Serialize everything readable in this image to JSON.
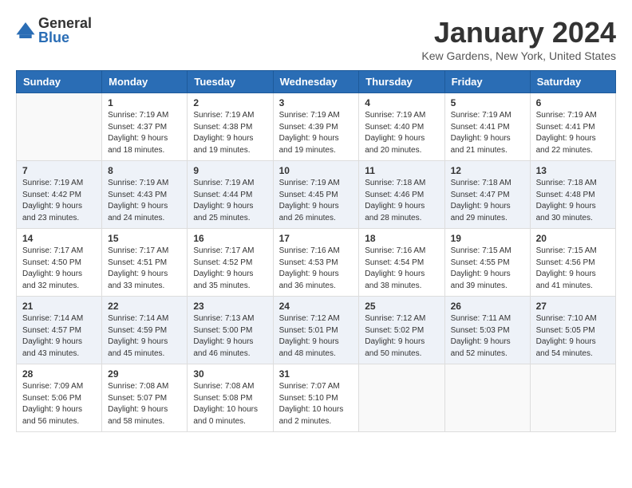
{
  "header": {
    "logo_general": "General",
    "logo_blue": "Blue",
    "month_year": "January 2024",
    "location": "Kew Gardens, New York, United States"
  },
  "days_of_week": [
    "Sunday",
    "Monday",
    "Tuesday",
    "Wednesday",
    "Thursday",
    "Friday",
    "Saturday"
  ],
  "weeks": [
    [
      {
        "day": "",
        "sunrise": "",
        "sunset": "",
        "daylight": "",
        "empty": true
      },
      {
        "day": "1",
        "sunrise": "Sunrise: 7:19 AM",
        "sunset": "Sunset: 4:37 PM",
        "daylight": "Daylight: 9 hours and 18 minutes."
      },
      {
        "day": "2",
        "sunrise": "Sunrise: 7:19 AM",
        "sunset": "Sunset: 4:38 PM",
        "daylight": "Daylight: 9 hours and 19 minutes."
      },
      {
        "day": "3",
        "sunrise": "Sunrise: 7:19 AM",
        "sunset": "Sunset: 4:39 PM",
        "daylight": "Daylight: 9 hours and 19 minutes."
      },
      {
        "day": "4",
        "sunrise": "Sunrise: 7:19 AM",
        "sunset": "Sunset: 4:40 PM",
        "daylight": "Daylight: 9 hours and 20 minutes."
      },
      {
        "day": "5",
        "sunrise": "Sunrise: 7:19 AM",
        "sunset": "Sunset: 4:41 PM",
        "daylight": "Daylight: 9 hours and 21 minutes."
      },
      {
        "day": "6",
        "sunrise": "Sunrise: 7:19 AM",
        "sunset": "Sunset: 4:41 PM",
        "daylight": "Daylight: 9 hours and 22 minutes."
      }
    ],
    [
      {
        "day": "7",
        "sunrise": "Sunrise: 7:19 AM",
        "sunset": "Sunset: 4:42 PM",
        "daylight": "Daylight: 9 hours and 23 minutes."
      },
      {
        "day": "8",
        "sunrise": "Sunrise: 7:19 AM",
        "sunset": "Sunset: 4:43 PM",
        "daylight": "Daylight: 9 hours and 24 minutes."
      },
      {
        "day": "9",
        "sunrise": "Sunrise: 7:19 AM",
        "sunset": "Sunset: 4:44 PM",
        "daylight": "Daylight: 9 hours and 25 minutes."
      },
      {
        "day": "10",
        "sunrise": "Sunrise: 7:19 AM",
        "sunset": "Sunset: 4:45 PM",
        "daylight": "Daylight: 9 hours and 26 minutes."
      },
      {
        "day": "11",
        "sunrise": "Sunrise: 7:18 AM",
        "sunset": "Sunset: 4:46 PM",
        "daylight": "Daylight: 9 hours and 28 minutes."
      },
      {
        "day": "12",
        "sunrise": "Sunrise: 7:18 AM",
        "sunset": "Sunset: 4:47 PM",
        "daylight": "Daylight: 9 hours and 29 minutes."
      },
      {
        "day": "13",
        "sunrise": "Sunrise: 7:18 AM",
        "sunset": "Sunset: 4:48 PM",
        "daylight": "Daylight: 9 hours and 30 minutes."
      }
    ],
    [
      {
        "day": "14",
        "sunrise": "Sunrise: 7:17 AM",
        "sunset": "Sunset: 4:50 PM",
        "daylight": "Daylight: 9 hours and 32 minutes."
      },
      {
        "day": "15",
        "sunrise": "Sunrise: 7:17 AM",
        "sunset": "Sunset: 4:51 PM",
        "daylight": "Daylight: 9 hours and 33 minutes."
      },
      {
        "day": "16",
        "sunrise": "Sunrise: 7:17 AM",
        "sunset": "Sunset: 4:52 PM",
        "daylight": "Daylight: 9 hours and 35 minutes."
      },
      {
        "day": "17",
        "sunrise": "Sunrise: 7:16 AM",
        "sunset": "Sunset: 4:53 PM",
        "daylight": "Daylight: 9 hours and 36 minutes."
      },
      {
        "day": "18",
        "sunrise": "Sunrise: 7:16 AM",
        "sunset": "Sunset: 4:54 PM",
        "daylight": "Daylight: 9 hours and 38 minutes."
      },
      {
        "day": "19",
        "sunrise": "Sunrise: 7:15 AM",
        "sunset": "Sunset: 4:55 PM",
        "daylight": "Daylight: 9 hours and 39 minutes."
      },
      {
        "day": "20",
        "sunrise": "Sunrise: 7:15 AM",
        "sunset": "Sunset: 4:56 PM",
        "daylight": "Daylight: 9 hours and 41 minutes."
      }
    ],
    [
      {
        "day": "21",
        "sunrise": "Sunrise: 7:14 AM",
        "sunset": "Sunset: 4:57 PM",
        "daylight": "Daylight: 9 hours and 43 minutes."
      },
      {
        "day": "22",
        "sunrise": "Sunrise: 7:14 AM",
        "sunset": "Sunset: 4:59 PM",
        "daylight": "Daylight: 9 hours and 45 minutes."
      },
      {
        "day": "23",
        "sunrise": "Sunrise: 7:13 AM",
        "sunset": "Sunset: 5:00 PM",
        "daylight": "Daylight: 9 hours and 46 minutes."
      },
      {
        "day": "24",
        "sunrise": "Sunrise: 7:12 AM",
        "sunset": "Sunset: 5:01 PM",
        "daylight": "Daylight: 9 hours and 48 minutes."
      },
      {
        "day": "25",
        "sunrise": "Sunrise: 7:12 AM",
        "sunset": "Sunset: 5:02 PM",
        "daylight": "Daylight: 9 hours and 50 minutes."
      },
      {
        "day": "26",
        "sunrise": "Sunrise: 7:11 AM",
        "sunset": "Sunset: 5:03 PM",
        "daylight": "Daylight: 9 hours and 52 minutes."
      },
      {
        "day": "27",
        "sunrise": "Sunrise: 7:10 AM",
        "sunset": "Sunset: 5:05 PM",
        "daylight": "Daylight: 9 hours and 54 minutes."
      }
    ],
    [
      {
        "day": "28",
        "sunrise": "Sunrise: 7:09 AM",
        "sunset": "Sunset: 5:06 PM",
        "daylight": "Daylight: 9 hours and 56 minutes."
      },
      {
        "day": "29",
        "sunrise": "Sunrise: 7:08 AM",
        "sunset": "Sunset: 5:07 PM",
        "daylight": "Daylight: 9 hours and 58 minutes."
      },
      {
        "day": "30",
        "sunrise": "Sunrise: 7:08 AM",
        "sunset": "Sunset: 5:08 PM",
        "daylight": "Daylight: 10 hours and 0 minutes."
      },
      {
        "day": "31",
        "sunrise": "Sunrise: 7:07 AM",
        "sunset": "Sunset: 5:10 PM",
        "daylight": "Daylight: 10 hours and 2 minutes."
      },
      {
        "day": "",
        "sunrise": "",
        "sunset": "",
        "daylight": "",
        "empty": true
      },
      {
        "day": "",
        "sunrise": "",
        "sunset": "",
        "daylight": "",
        "empty": true
      },
      {
        "day": "",
        "sunrise": "",
        "sunset": "",
        "daylight": "",
        "empty": true
      }
    ]
  ]
}
